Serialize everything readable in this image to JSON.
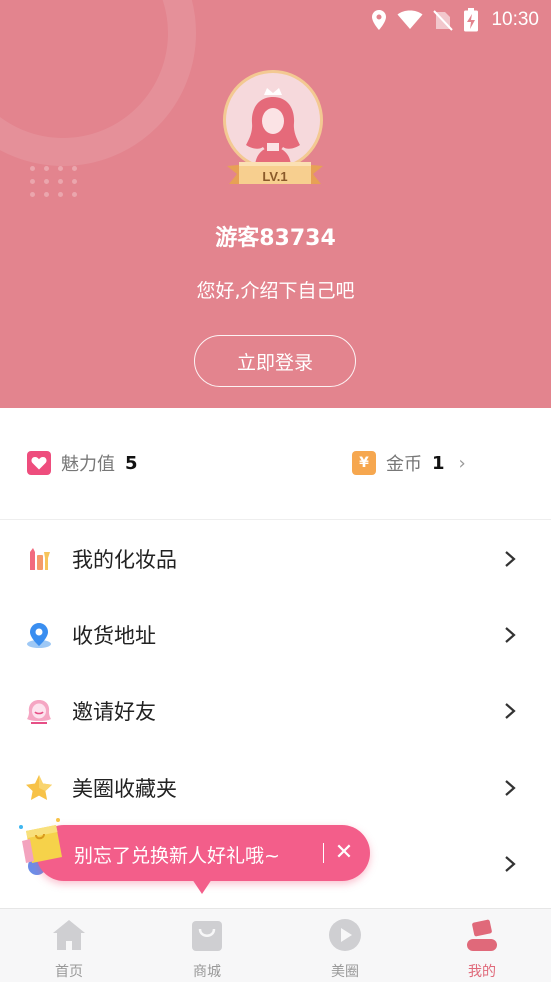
{
  "status_bar": {
    "time": "10:30"
  },
  "profile": {
    "level": "LV.1",
    "username": "游客83734",
    "greeting": "您好,介绍下自己吧",
    "login_button": "立即登录"
  },
  "stats": {
    "charm": {
      "label": "魅力值",
      "value": "5"
    },
    "coins": {
      "label": "金币",
      "value": "1",
      "currency_symbol": "¥"
    }
  },
  "menu": [
    {
      "label": "我的化妆品",
      "icon": "cosmetics-icon"
    },
    {
      "label": "收货地址",
      "icon": "location-pin-icon"
    },
    {
      "label": "邀请好友",
      "icon": "invite-friend-icon"
    },
    {
      "label": "美圈收藏夹",
      "icon": "star-icon"
    },
    {
      "label": "",
      "icon": "partial-hidden-icon"
    }
  ],
  "toast": {
    "text": "别忘了兑换新人好礼哦~",
    "close": "✕"
  },
  "tabbar": [
    {
      "label": "首页",
      "icon": "home-icon",
      "active": false
    },
    {
      "label": "商城",
      "icon": "shopping-bag-icon",
      "active": false
    },
    {
      "label": "美圈",
      "icon": "play-icon",
      "active": false
    },
    {
      "label": "我的",
      "icon": "user-icon",
      "active": true
    }
  ],
  "colors": {
    "header_bg": "#e3848e",
    "accent_pink": "#f35e8a",
    "active_tab": "#e0697a",
    "coin_orange": "#f6a74f"
  }
}
